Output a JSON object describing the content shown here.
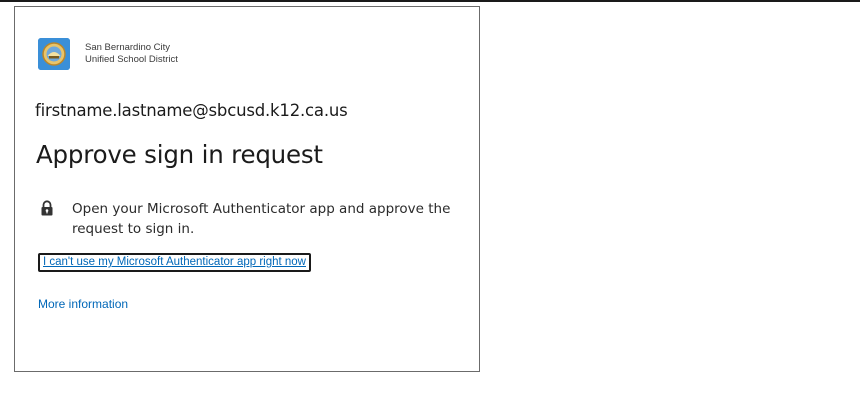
{
  "org": {
    "name_line1": "San Bernardino City",
    "name_line2": "Unified School District",
    "logo_icon": "district-seal-icon"
  },
  "identity": "firstname.lastname@sbcusd.k12.ca.us",
  "title": "Approve sign in request",
  "instruction": {
    "icon": "lock-icon",
    "text": "Open your Microsoft Authenticator app and approve the request to sign in."
  },
  "links": {
    "alt_method": "I can't use my Microsoft Authenticator app right now",
    "more_info": "More information"
  },
  "colors": {
    "link": "#0067b8",
    "text": "#1b1b1b",
    "logo_bg": "#3a8fd8",
    "card_border": "#6b6b6b"
  }
}
